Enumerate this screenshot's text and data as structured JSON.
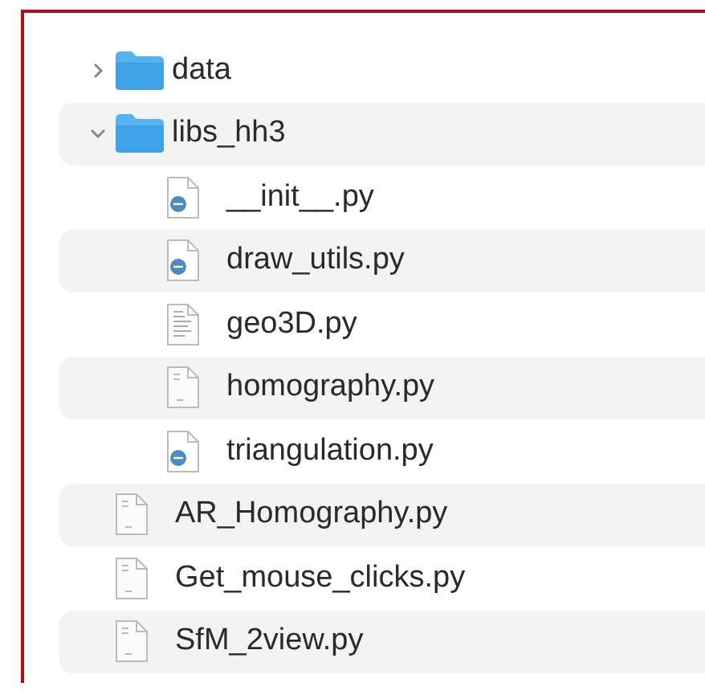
{
  "tree": [
    {
      "kind": "folder",
      "name": "data",
      "expanded": false
    },
    {
      "kind": "folder",
      "name": "libs_hh3",
      "expanded": true,
      "children": [
        {
          "kind": "python",
          "name": "__init__.py"
        },
        {
          "kind": "python",
          "name": "draw_utils.py"
        },
        {
          "kind": "text",
          "name": "geo3D.py"
        },
        {
          "kind": "plain",
          "name": "homography.py"
        },
        {
          "kind": "python",
          "name": "triangulation.py"
        }
      ]
    },
    {
      "kind": "plain",
      "name": "AR_Homography.py"
    },
    {
      "kind": "plain",
      "name": "Get_mouse_clicks.py"
    },
    {
      "kind": "plain",
      "name": "SfM_2view.py"
    }
  ]
}
